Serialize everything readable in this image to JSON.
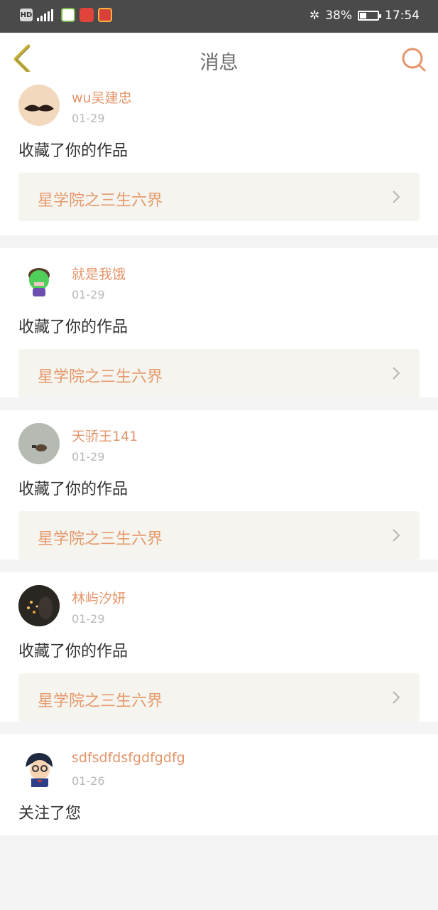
{
  "status_bar": {
    "left_icons": [
      "hd-icon",
      "signal-4g-icon",
      "app-icon-green",
      "app-icon-toutiao",
      "app-icon-red"
    ],
    "hd": "HD",
    "battery": "38%",
    "battery_level": 0.38,
    "time": "17:54"
  },
  "nav": {
    "title": "消息",
    "back_icon": "chevron-left-icon",
    "search_icon": "search-icon"
  },
  "colors": {
    "accent": "#e4956a",
    "back_icon": "#c7b23a"
  },
  "notifications": [
    {
      "username": "wu吴建忠",
      "date": "01-29",
      "action": "收藏了你的作品",
      "work_title": "星学院之三生六界",
      "avatar": "mustache-avatar"
    },
    {
      "username": "就是我饿",
      "date": "01-29",
      "action": "收藏了你的作品",
      "work_title": "星学院之三生六界",
      "avatar": "green-cartoon-avatar"
    },
    {
      "username": "天骄王141",
      "date": "01-29",
      "action": "收藏了你的作品",
      "work_title": "星学院之三生六界",
      "avatar": "gray-avatar"
    },
    {
      "username": "林屿汐妍",
      "date": "01-29",
      "action": "收藏了你的作品",
      "work_title": "星学院之三生六界",
      "avatar": "night-lights-avatar"
    },
    {
      "username": "sdfsdfdsfgdfgdfg",
      "date": "01-26",
      "action": "关注了您",
      "avatar": "anime-avatar"
    }
  ]
}
